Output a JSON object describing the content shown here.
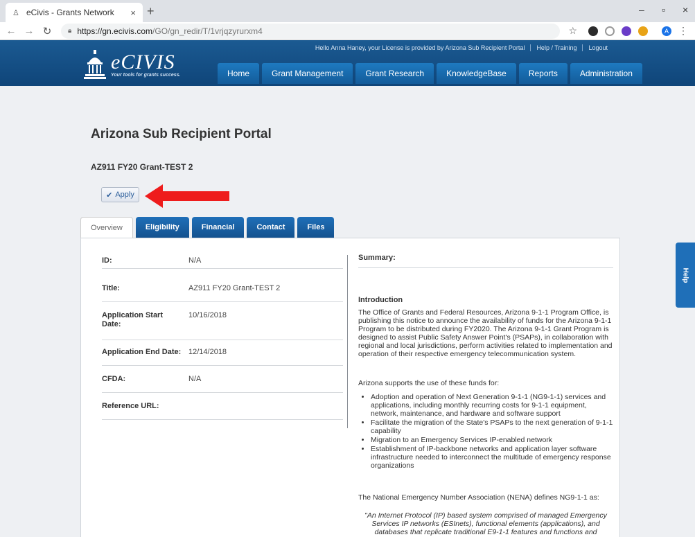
{
  "browser": {
    "tab_title": "eCivis - Grants Network",
    "tab_close": "×",
    "new_tab": "+",
    "url_base": "https://gn.ecivis.com",
    "url_path": "/GO/gn_redir/T/1vrjqzyrurxm4",
    "minimize": "–",
    "maximize": "▫",
    "close": "×",
    "profile_initial": "A"
  },
  "header": {
    "logo_name": "eCIVIS",
    "logo_tagline": "Your tools for grants success.",
    "greeting": "Hello Anna Haney, your License is provided by Arizona Sub Recipient Portal",
    "help_training": "Help / Training",
    "logout": "Logout",
    "nav": [
      "Home",
      "Grant Management",
      "Grant Research",
      "KnowledgeBase",
      "Reports",
      "Administration"
    ]
  },
  "page": {
    "title": "Arizona Sub Recipient Portal",
    "grant_name": "AZ911 FY20 Grant-TEST 2",
    "apply_label": "Apply"
  },
  "tabs": [
    "Overview",
    "Eligibility",
    "Financial",
    "Contact",
    "Files"
  ],
  "fields": {
    "id_label": "ID:",
    "id_value": "N/A",
    "title_label": "Title:",
    "title_value": "AZ911 FY20 Grant-TEST 2",
    "start_label": "Application Start Date:",
    "start_value": "10/16/2018",
    "end_label": "Application End Date:",
    "end_value": "12/14/2018",
    "cfda_label": "CFDA:",
    "cfda_value": "N/A",
    "ref_label": "Reference URL:",
    "ref_value": ""
  },
  "summary": {
    "heading": "Summary:",
    "intro_heading": "Introduction",
    "intro_text": "The Office of Grants and Federal Resources, Arizona 9-1-1 Program Office, is publishing this notice to announce the availability of funds for the Arizona 9-1-1 Program to be distributed during FY2020. The Arizona 9-1-1 Grant Program is designed to assist Public Safety Answer Point's (PSAPs), in collaboration with regional and local jurisdictions, perform activities related to implementation and operation of their respective emergency telecommunication system.",
    "supports_text": "Arizona supports the use of these funds for:",
    "bullets": [
      "Adoption and operation of Next Generation 9-1-1 (NG9-1-1) services and applications, including monthly recurring costs for 9-1-1 equipment, network, maintenance, and hardware and software support",
      "Facilitate the migration of the State's PSAPs to the next generation of 9-1-1 capability",
      "Migration to an Emergency Services IP-enabled network",
      "Establishment of IP-backbone networks and application layer software infrastructure needed to interconnect the multitude of emergency response organizations"
    ],
    "nena_text": "The National Emergency Number Association (NENA) defines NG9-1-1 as:",
    "quote_text": "\"An Internet Protocol (IP) based system comprised of managed Emergency Services IP networks (ESInets), functional elements (applications), and databases that replicate traditional E9-1-1 features and functions and"
  },
  "help_tab": "Help"
}
